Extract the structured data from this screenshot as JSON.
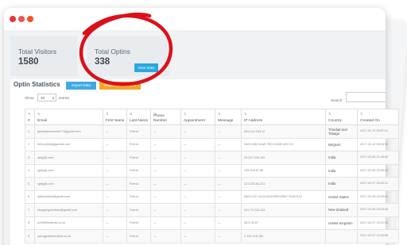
{
  "colors": {
    "accent_red": "#e53935",
    "primary_blue": "#29a8e0",
    "orange": "#f5a623",
    "annotation_red": "#d9111b"
  },
  "window": {
    "control_icons": [
      "close-dot-icon",
      "minimize-dot-icon",
      "maximize-dot-icon"
    ]
  },
  "stats": {
    "total_visitors": {
      "label": "Total Visitors",
      "value": "1580"
    },
    "total_optins": {
      "label": "Total Optins",
      "value": "338",
      "button": "View Stats"
    }
  },
  "optin_stats": {
    "title": "Optin Statistics",
    "export_label": "Export Data",
    "view_label": "View/Download CSV",
    "show_label": "Show",
    "entries_value": "10",
    "entries_label": "entries",
    "search_label": "Search:",
    "columns": [
      "#",
      "Email",
      "First Name",
      "Last Name",
      "Phone Number",
      "Appointment",
      "Message",
      "IP Address",
      "Country",
      "Created On"
    ],
    "rows": [
      [
        "1",
        "jamesjamessmith77@gmail.com",
        "—",
        "Friend",
        "—",
        "—",
        "—",
        "209.212.233.12",
        "Trinidad and Tobago",
        "2017-02-10 08:57:01"
      ],
      [
        "2",
        "henry.dal@gigamail.com",
        "—",
        "Friend",
        "—",
        "—",
        "—",
        "2a02:1811:b1a9:7f00:f:1b08:1297:10",
        "Belgium",
        "2017-02-10 06:03:30"
      ],
      [
        "3",
        "akdg@.com",
        "—",
        "Friend",
        "—",
        "—",
        "—",
        "49.207.205.165",
        "India",
        "2017-02-09 21:45:52"
      ],
      [
        "4",
        "rgkfg@.com",
        "—",
        "Friend",
        "—",
        "—",
        "—",
        "106.208.97.65",
        "India",
        "2017-02-09 19:05:49"
      ],
      [
        "5",
        "rgkfg@.com",
        "—",
        "Friend",
        "—",
        "—",
        "—",
        "127.233.84.221",
        "India",
        "2017-02-07 18:42:11"
      ],
      [
        "6",
        "darkomarlio@gmail.com",
        "—",
        "Friend",
        "—",
        "—",
        "—",
        "2600:1017:b41f:4449:f999:2f5b7:7b16:f129",
        "United States",
        "2017-02-08 18:29:02"
      ],
      [
        "7",
        "shoppingdontime@gmail.com",
        "—",
        "Friend",
        "—",
        "—",
        "—",
        "121.79.244.224",
        "New Zealand",
        "2017-02-06 23:15:26"
      ],
      [
        "8",
        "pcl1ft@hotmail.co.uk",
        "—",
        "Friend",
        "—",
        "—",
        "—",
        "93.2.28.87",
        "United Kingdom",
        "2017-02-07 16:12:03"
      ],
      [
        "9",
        "nauogptephen@ail.co.uk",
        "—",
        "Friend",
        "—",
        "—",
        "—",
        "2.100.218.184",
        "",
        "2017-02-07 12:04:55"
      ]
    ]
  }
}
